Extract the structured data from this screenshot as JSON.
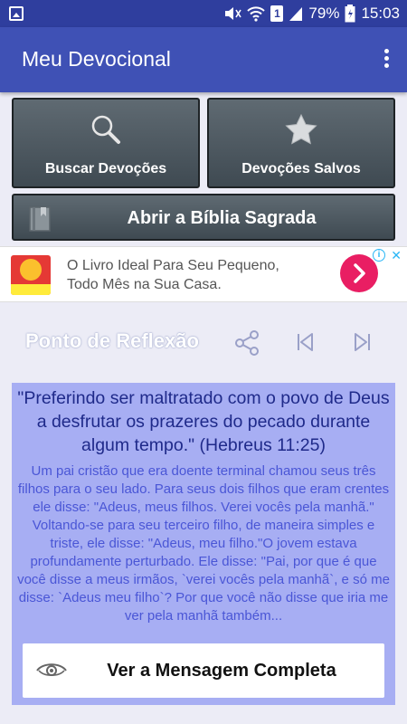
{
  "status_bar": {
    "battery": "79%",
    "time": "15:03",
    "sim": "1"
  },
  "app_bar": {
    "title": "Meu Devocional"
  },
  "tiles": {
    "search": "Buscar Devoções",
    "saved": "Devoções Salvos",
    "bible": "Abrir a Bíblia Sagrada"
  },
  "ad": {
    "line1": "O Livro Ideal Para Seu Pequeno,",
    "line2": "Todo Mês na Sua Casa.",
    "close": "✕",
    "info": "i"
  },
  "reflection": {
    "title": "Ponto de Reflexão"
  },
  "verse": {
    "text": "\"Preferindo ser maltratado com o povo de Deus a desfrutar os prazeres do pecado durante algum tempo.\" (Hebreus 11:25)",
    "body": "Um pai cristão que era doente terminal chamou seus três filhos para o seu lado. Para seus dois filhos que eram crentes ele disse: \"Adeus, meus filhos. Verei vocês pela manhã.\" Voltando-se para seu terceiro filho, de maneira simples e triste, ele disse: \"Adeus, meu filho.\"O jovem estava profundamente perturbado. Ele disse: \"Pai, por que é que você disse a meus irmãos, `verei vocês pela manhã`, e só me disse: `Adeus meu filho`? Por que você não disse que iria me ver pela manhã também..."
  },
  "view_button": {
    "label": "Ver a Mensagem Completa"
  },
  "colors": {
    "status_bar": "#2f3e9e",
    "app_bar": "#3f51b5",
    "verse_card": "#a7aef3",
    "ad_accent": "#e91e63"
  }
}
